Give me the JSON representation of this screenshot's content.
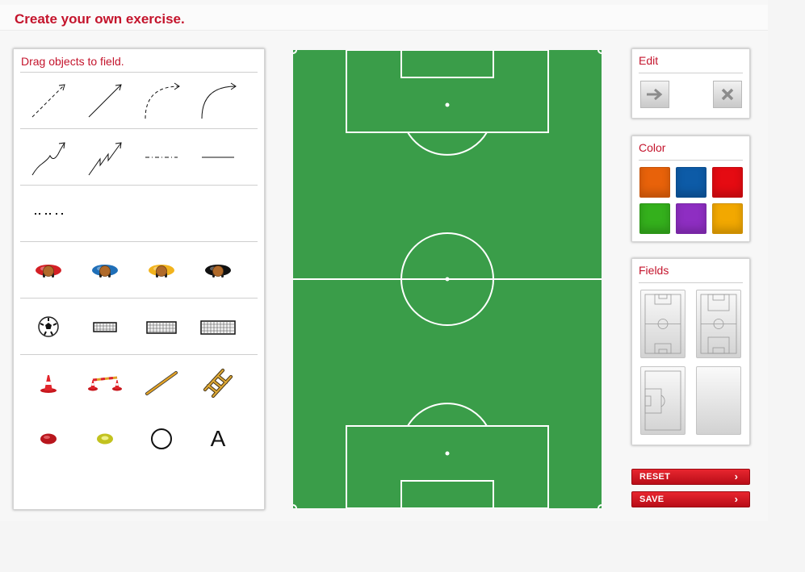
{
  "page": {
    "title": "Create your own exercise."
  },
  "objects_panel": {
    "title": "Drag objects to field.",
    "rows": [
      [
        "dashed-arrow",
        "solid-arrow",
        "curved-dashed-arrow",
        "curved-arrow"
      ],
      [
        "wavy-arrow",
        "zigzag-arrow",
        "dash-dot-line",
        "solid-line"
      ],
      [
        "dotted-line"
      ],
      [
        "player-red",
        "player-blue",
        "player-yellow",
        "player-black"
      ],
      [
        "ball",
        "goal-small",
        "goal-medium",
        "goal-large"
      ],
      [
        "cone",
        "hurdle",
        "pole",
        "ladder"
      ],
      [
        "marker-red",
        "marker-yellow",
        "circle",
        "text"
      ]
    ],
    "text_tool_label": "A"
  },
  "colors": {
    "accent": "#c4142c",
    "field_green": "#3a9d49",
    "player_red": "#d41f25",
    "player_blue": "#1f6fb8",
    "player_yellow": "#f2b31d",
    "player_black": "#111111"
  },
  "edit_panel": {
    "title": "Edit",
    "buttons": [
      "arrow-right-icon",
      "close-icon"
    ]
  },
  "color_panel": {
    "title": "Color",
    "swatches": [
      "#e8620a",
      "#0d5ba7",
      "#e50b12",
      "#34b01c",
      "#8e2ec2",
      "#f2a800"
    ]
  },
  "fields_panel": {
    "title": "Fields",
    "options": [
      "full-field",
      "full-field-alt",
      "half-field",
      "blank-field"
    ]
  },
  "actions": {
    "reset_label": "RESET",
    "save_label": "SAVE",
    "chevron": "›"
  }
}
